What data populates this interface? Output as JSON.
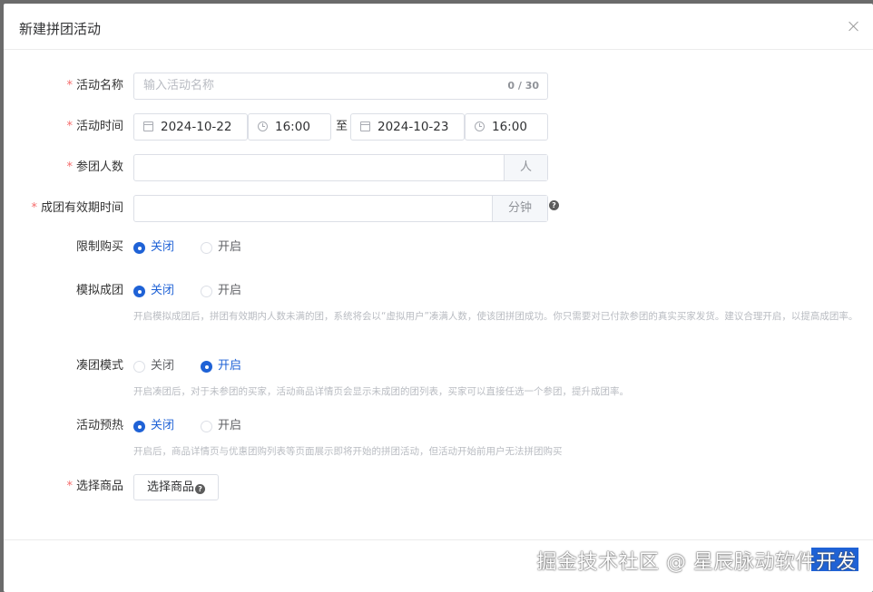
{
  "dialog": {
    "title": "新建拼团活动",
    "close_icon": "close-icon"
  },
  "form": {
    "activity_name": {
      "label": "活动名称",
      "required": "*",
      "placeholder": "输入活动名称",
      "count": "0 / 30"
    },
    "activity_time": {
      "label": "活动时间",
      "required": "*",
      "start_date": "2024-10-22",
      "start_time": "16:00",
      "separator": "至",
      "end_date": "2024-10-23",
      "end_time": "16:00"
    },
    "group_size": {
      "label": "参团人数",
      "required": "*",
      "value": "",
      "unit": "人"
    },
    "group_valid_time": {
      "label": "成团有效期时间",
      "required": "*",
      "value": "",
      "unit": "分钟",
      "help_icon": "?"
    },
    "purchase_limit": {
      "label": "限制购买",
      "options": [
        "关闭",
        "开启"
      ],
      "selected": "关闭"
    },
    "simulated_group": {
      "label": "模拟成团",
      "options": [
        "关闭",
        "开启"
      ],
      "selected": "关闭",
      "hint": "开启模拟成团后，拼团有效期内人数未满的团，系统将会以“虚拟用户”凑满人数，使该团拼团成功。你只需要对已付款参团的真实买家发货。建议合理开启，以提高成团率。"
    },
    "join_mode": {
      "label": "凑团模式",
      "options": [
        "关闭",
        "开启"
      ],
      "selected": "开启",
      "hint": "开启凑团后，对于未参团的买家，活动商品详情页会显示未成团的团列表，买家可以直接任选一个参团，提升成团率。"
    },
    "preheat": {
      "label": "活动预热",
      "options": [
        "关闭",
        "开启"
      ],
      "selected": "关闭",
      "hint": "开启后，商品详情页与优惠团购列表等页面展示即将开始的拼团活动，但活动开始前用户无法拼团购买"
    },
    "select_goods": {
      "label": "选择商品",
      "required": "*",
      "button_label": "选择商品",
      "help_icon": "?"
    }
  },
  "watermark": "掘金技术社区 @ 星辰脉动软件开发",
  "colors": {
    "primary": "#1f62d6",
    "required": "#f56c6c",
    "border": "#dcdfe6",
    "hint": "#b9bcc2"
  }
}
